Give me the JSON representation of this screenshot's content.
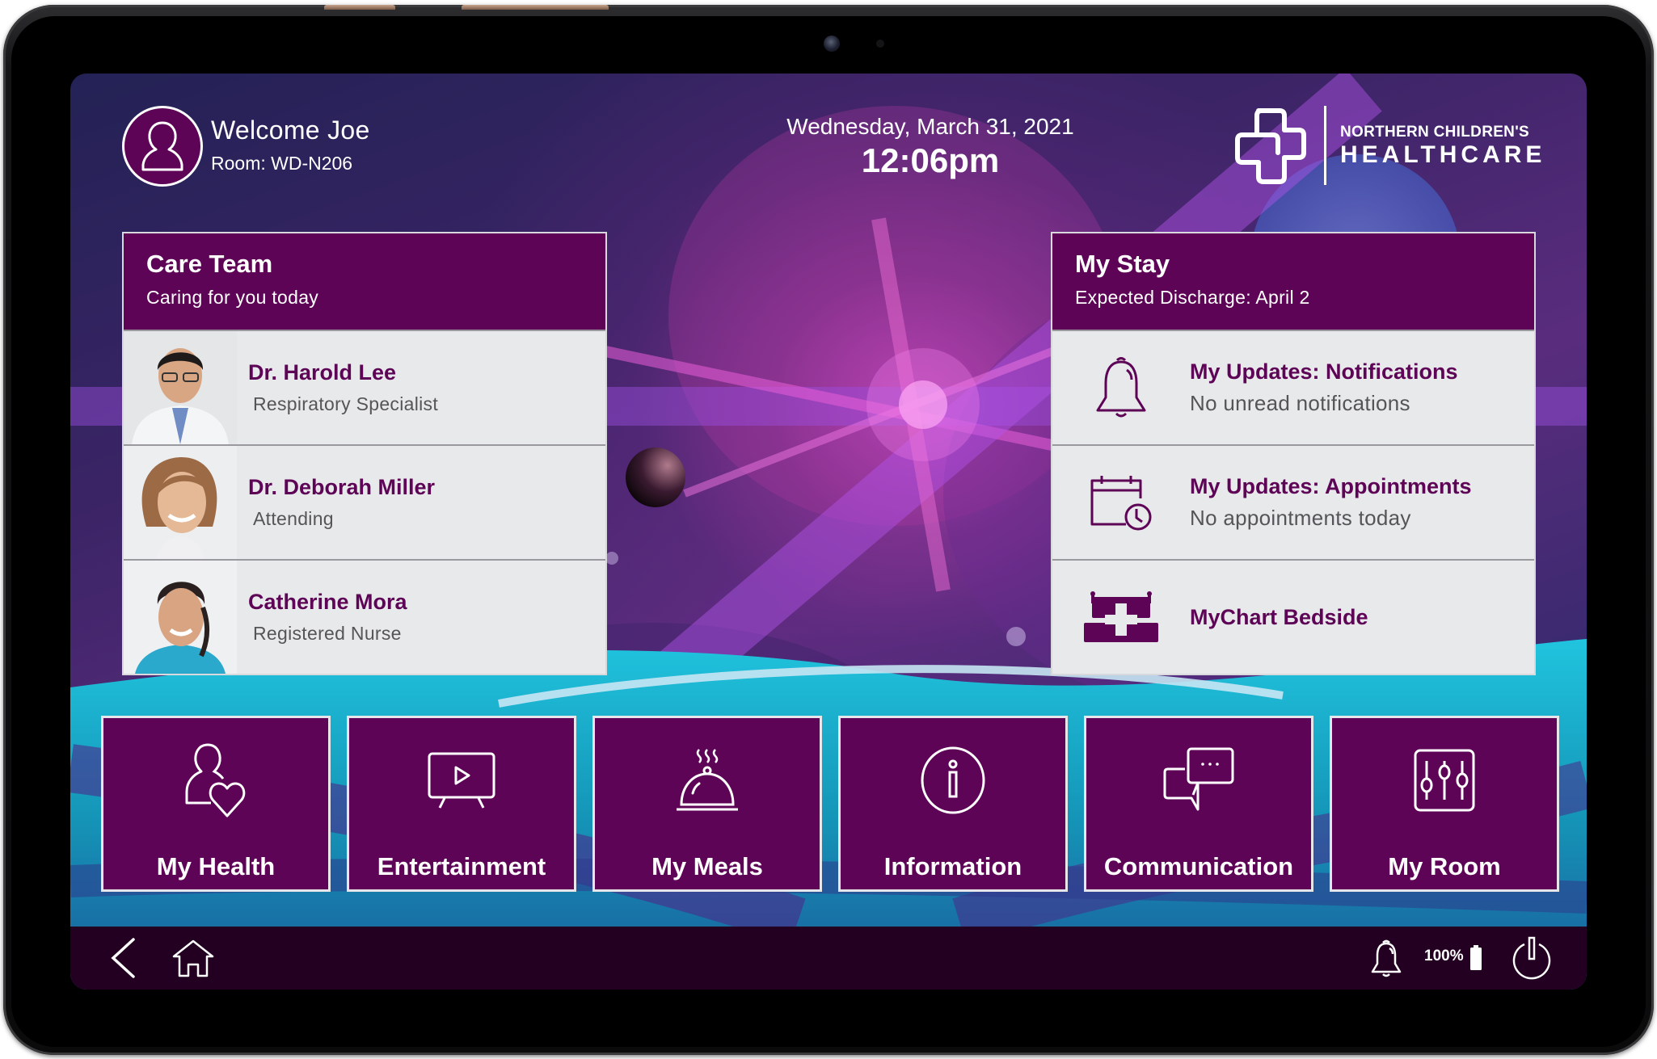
{
  "header": {
    "welcome": "Welcome Joe",
    "room": "Room: WD-N206",
    "date": "Wednesday, March 31, 2021",
    "time": "12:06pm",
    "logo": {
      "line1": "NORTHERN CHILDREN'S",
      "line2": "HEALTHCARE"
    }
  },
  "care_team": {
    "title": "Care Team",
    "subtitle": "Caring for you today",
    "members": [
      {
        "name": "Dr. Harold Lee",
        "role": "Respiratory Specialist",
        "photo": "doctor-portrait-male"
      },
      {
        "name": "Dr. Deborah Miller",
        "role": "Attending",
        "photo": "doctor-portrait-female"
      },
      {
        "name": "Catherine Mora",
        "role": "Registered Nurse",
        "photo": "nurse-portrait-female"
      }
    ]
  },
  "my_stay": {
    "title": "My Stay",
    "subtitle": "Expected Discharge: April 2",
    "items": [
      {
        "title": "My Updates: Notifications",
        "subtitle": "No unread notifications",
        "icon": "bell-icon"
      },
      {
        "title": "My Updates: Appointments",
        "subtitle": "No appointments today",
        "icon": "calendar-clock-icon"
      },
      {
        "title": "MyChart Bedside",
        "subtitle": "",
        "icon": "hospital-bed-icon"
      }
    ]
  },
  "tiles": [
    {
      "label": "My Health",
      "icon": "person-heart-icon"
    },
    {
      "label": "Entertainment",
      "icon": "tv-play-icon"
    },
    {
      "label": "My Meals",
      "icon": "food-cloche-icon"
    },
    {
      "label": "Information",
      "icon": "info-icon"
    },
    {
      "label": "Communication",
      "icon": "chat-bubbles-icon"
    },
    {
      "label": "My Room",
      "icon": "sliders-icon"
    }
  ],
  "navbar": {
    "battery": "100%",
    "back_icon": "chevron-left-icon",
    "home_icon": "home-icon",
    "bell_icon": "bell-icon",
    "power_icon": "power-icon"
  },
  "colors": {
    "brand_purple": "#5e0456",
    "navbar_bg": "#230021",
    "panel_bg": "#e8e9eb",
    "role_text": "#555558"
  }
}
